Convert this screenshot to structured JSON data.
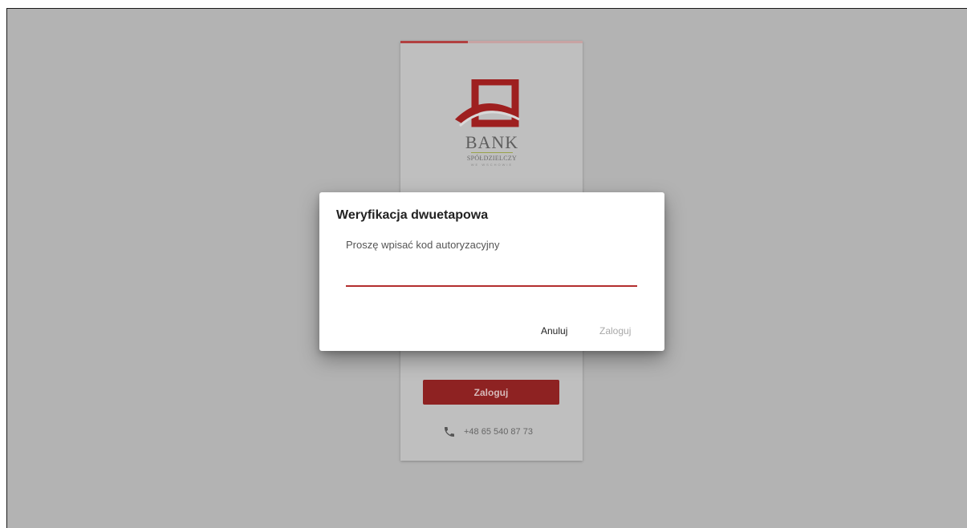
{
  "brand": {
    "title": "BANK",
    "subtitle": "SPÓŁDZIELCZY",
    "location": "WE WSCHOWIE",
    "accent_color": "#b32d2d",
    "icon": "bank-logo-icon"
  },
  "progress": {
    "fraction": 0.37
  },
  "login": {
    "button_label": "Zaloguj",
    "phone": "+48 65 540 87 73",
    "phone_icon": "phone-icon"
  },
  "dialog": {
    "title": "Weryfikacja dwuetapowa",
    "subtitle": "Proszę wpisać kod autoryzacyjny",
    "code_value": "",
    "cancel_label": "Anuluj",
    "confirm_label": "Zaloguj"
  }
}
